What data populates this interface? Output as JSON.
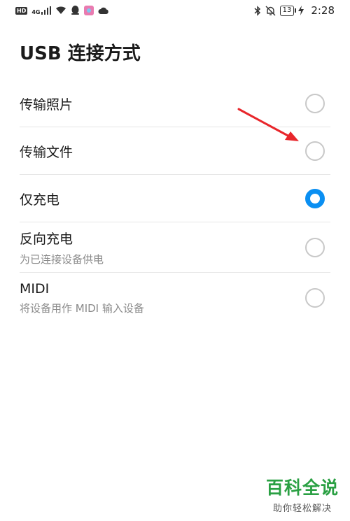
{
  "status_bar": {
    "hd_badge": "HD",
    "network": "4G",
    "battery": "13",
    "time": "2:28",
    "icons": [
      "signal-icon",
      "wifi-icon",
      "qq-icon",
      "app-icon",
      "cloud-icon",
      "bluetooth-icon",
      "mute-icon",
      "battery-icon",
      "charging-icon"
    ]
  },
  "page": {
    "title": "USB 连接方式"
  },
  "options": [
    {
      "label": "传输照片",
      "subtitle": "",
      "selected": false
    },
    {
      "label": "传输文件",
      "subtitle": "",
      "selected": false
    },
    {
      "label": "仅充电",
      "subtitle": "",
      "selected": true
    },
    {
      "label": "反向充电",
      "subtitle": "为已连接设备供电",
      "selected": false
    },
    {
      "label": "MIDI",
      "subtitle": "将设备用作 MIDI 输入设备",
      "selected": false
    }
  ],
  "annotation": {
    "color": "#e8262b"
  },
  "watermark": {
    "title": "百科全说",
    "subtitle": "助你轻松解决"
  },
  "colors": {
    "accent": "#0a8ff2",
    "watermark": "#2aa043"
  }
}
